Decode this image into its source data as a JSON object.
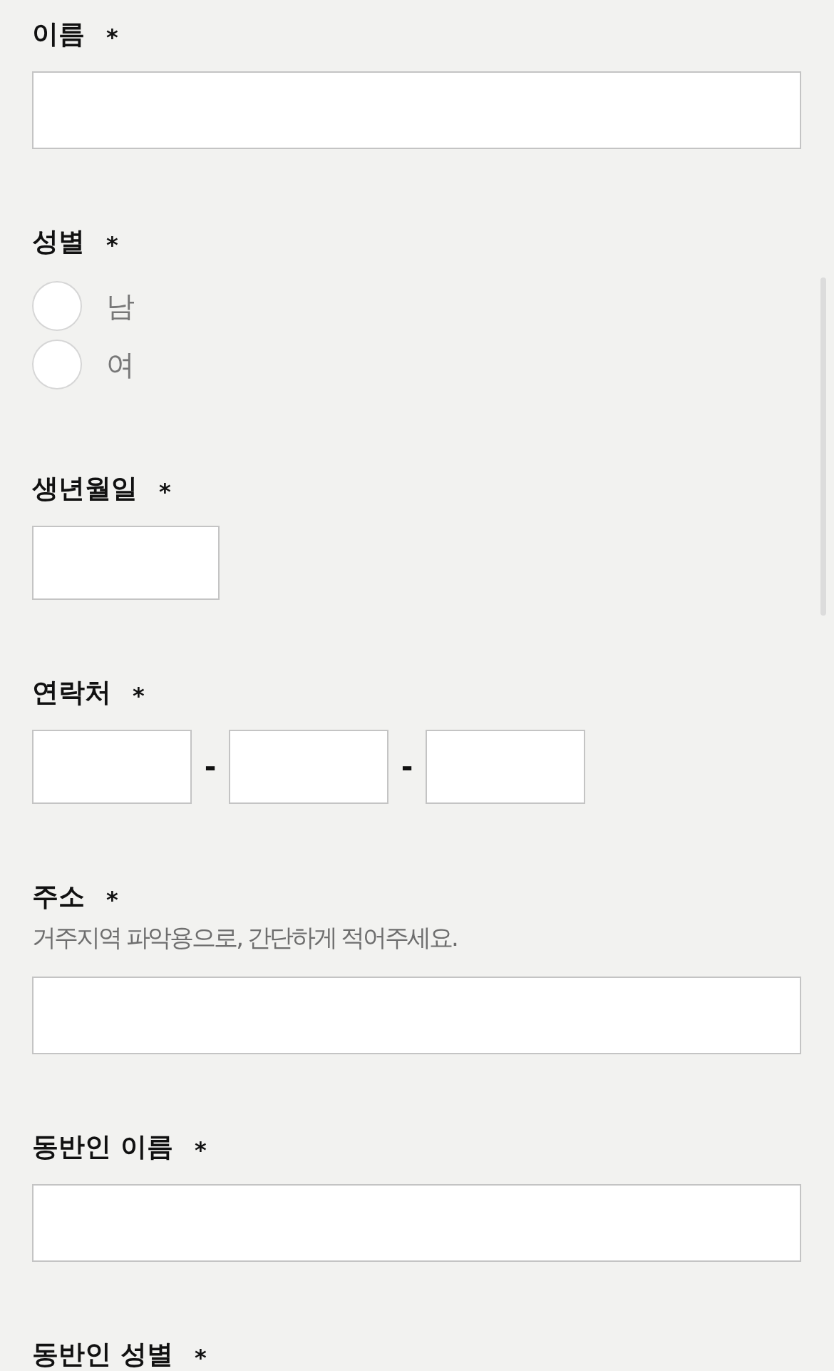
{
  "form": {
    "fields": [
      {
        "kind": "text",
        "label": "이름",
        "required_mark": "*"
      },
      {
        "kind": "radio",
        "label": "성별",
        "required_mark": "*",
        "options": [
          {
            "label": "남",
            "selected": false
          },
          {
            "label": "여",
            "selected": false
          }
        ]
      },
      {
        "kind": "date",
        "label": "생년월일",
        "required_mark": "*"
      },
      {
        "kind": "phone",
        "label": "연락처",
        "required_mark": "*",
        "separators": [
          "-",
          "-"
        ]
      },
      {
        "kind": "text",
        "label": "주소",
        "required_mark": "*",
        "hint": "거주지역 파악용으로, 간단하게 적어주세요."
      },
      {
        "kind": "text",
        "label": "동반인 이름",
        "required_mark": "*"
      },
      {
        "kind": "radio",
        "label": "동반인 성별",
        "required_mark": "*"
      }
    ]
  }
}
